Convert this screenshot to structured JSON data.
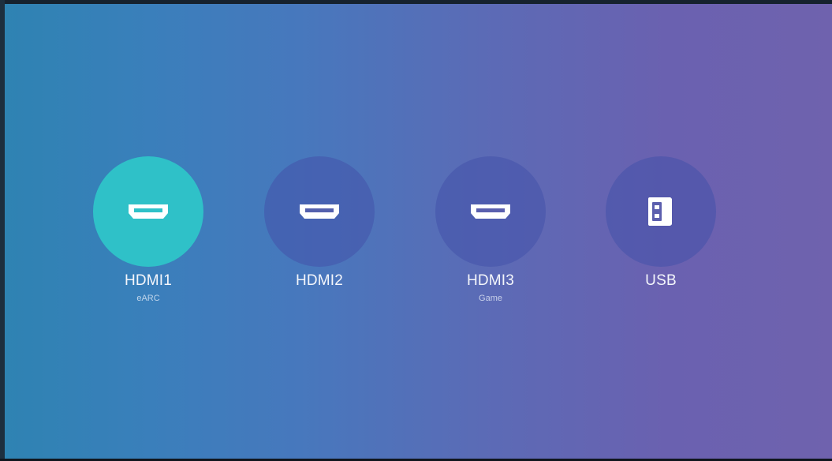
{
  "screen": {
    "title": "",
    "selected_index": 0
  },
  "colors": {
    "background_left": "#2e83b2",
    "background_right": "#6f62ae",
    "selected_circle": "#2fc1c8",
    "unselected_circle": "#4d57a8",
    "text": "#f4f6fb"
  },
  "sources": [
    {
      "label": "HDMI1",
      "sublabel": "eARC",
      "icon": "hdmi-port-icon",
      "selected": true
    },
    {
      "label": "HDMI2",
      "sublabel": "",
      "icon": "hdmi-port-icon",
      "selected": false
    },
    {
      "label": "HDMI3",
      "sublabel": "Game",
      "icon": "hdmi-port-icon",
      "selected": false
    },
    {
      "label": "USB",
      "sublabel": "",
      "icon": "usb-drive-icon",
      "selected": false
    }
  ]
}
